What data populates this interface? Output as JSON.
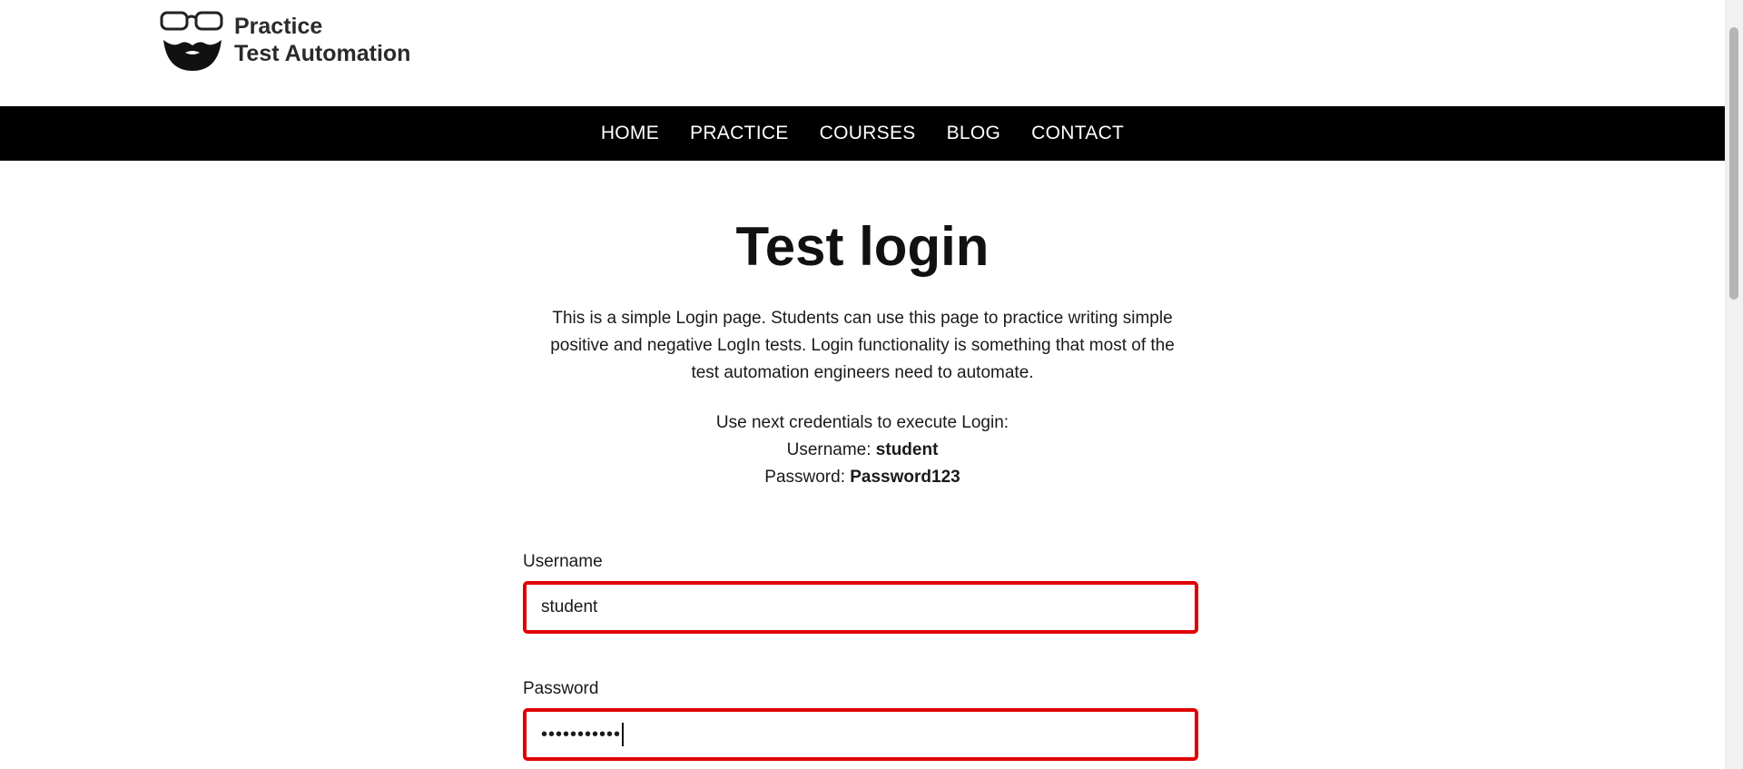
{
  "header": {
    "logo_line1": "Practice",
    "logo_line2": "Test Automation"
  },
  "nav": [
    "HOME",
    "PRACTICE",
    "COURSES",
    "BLOG",
    "CONTACT"
  ],
  "page": {
    "title": "Test login",
    "intro": "This is a simple Login page. Students can use this page to practice writing simple positive and negative LogIn tests. Login functionality is something that most of the test automation engineers need to automate.",
    "creds_intro": "Use next credentials to execute Login:",
    "username_label": "Username:",
    "username_value": "student",
    "password_label": "Password:",
    "password_value": "Password123"
  },
  "form": {
    "username_label": "Username",
    "username_value": "student",
    "password_label": "Password",
    "password_masked": "•••••••••••"
  },
  "colors": {
    "nav_bg": "#000000",
    "input_border": "#e00000"
  },
  "icons": {
    "logo": "bearded-face-glasses-icon"
  }
}
